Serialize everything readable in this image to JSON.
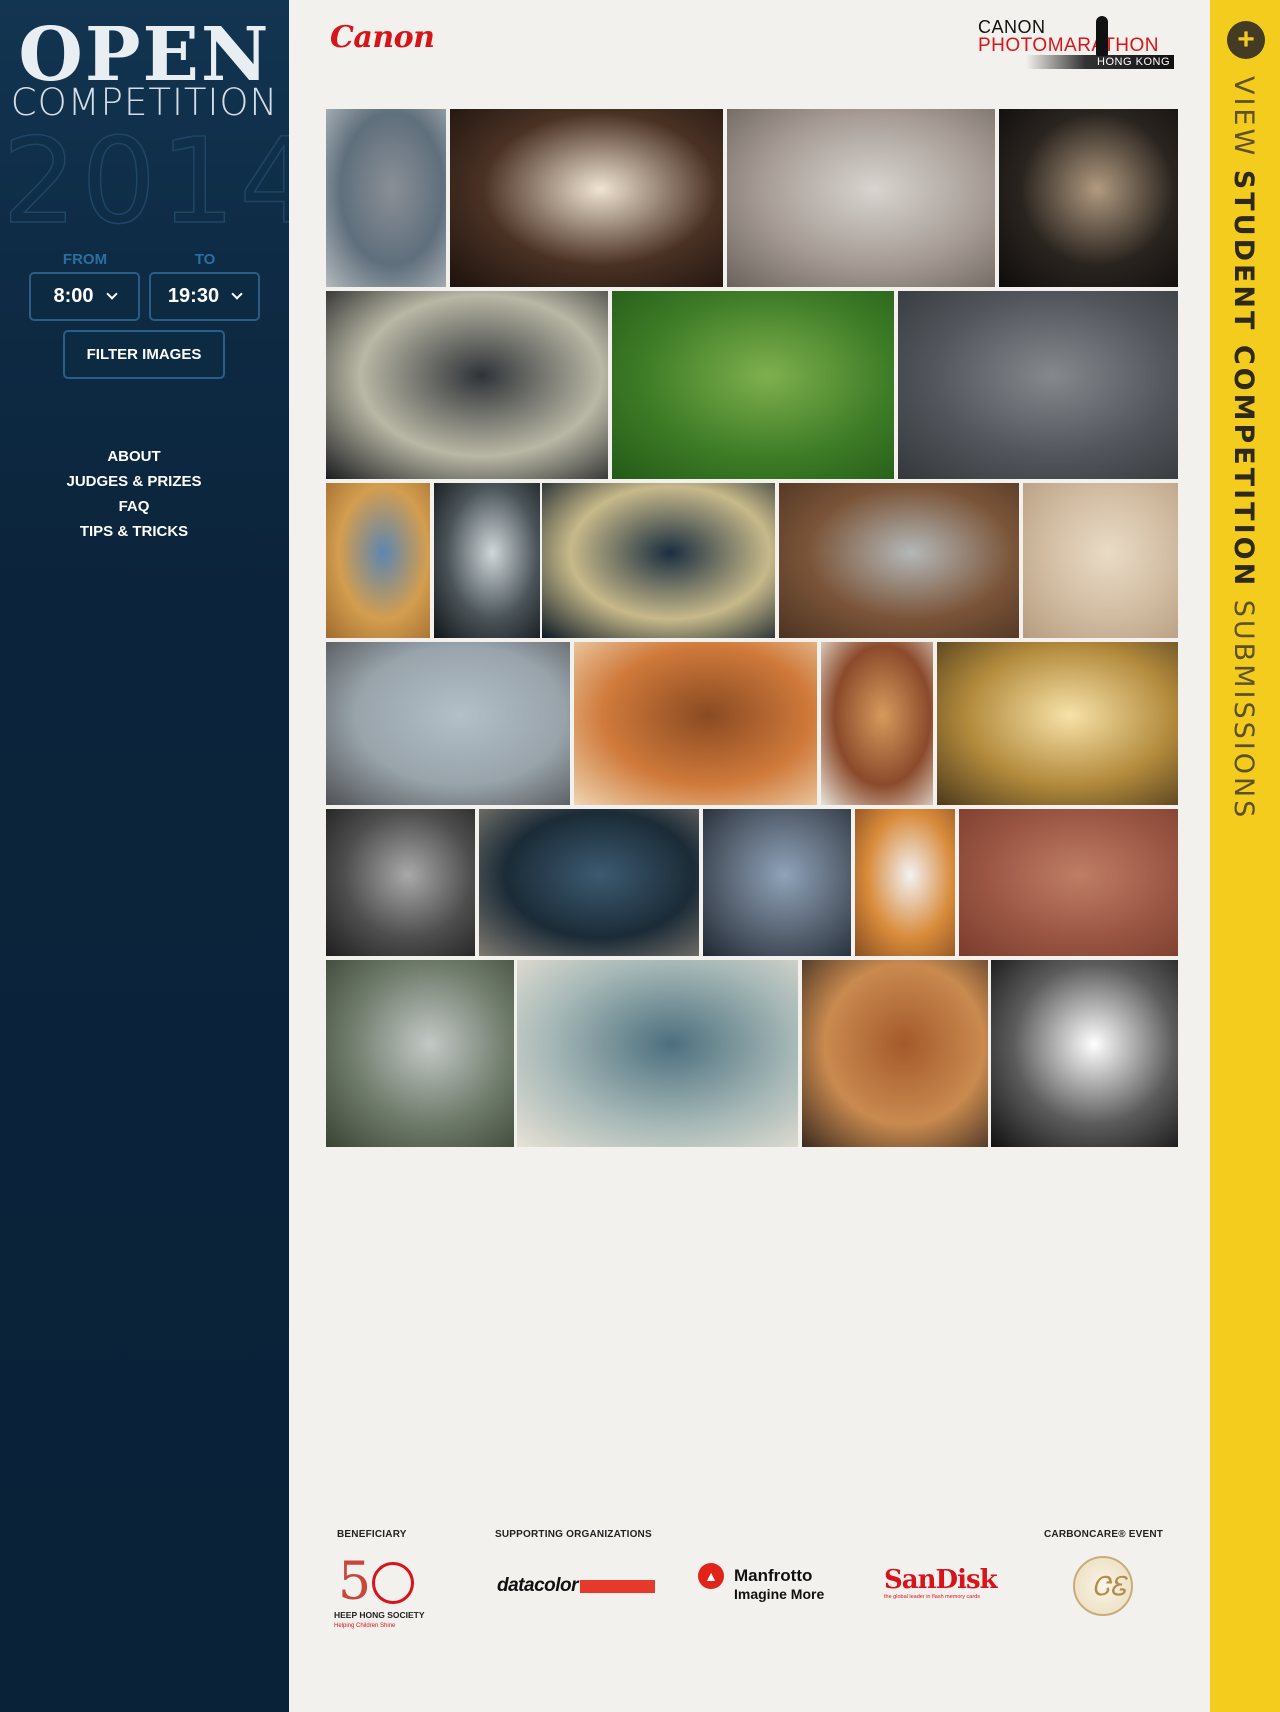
{
  "sidebar": {
    "logo_line1": "OPEN",
    "logo_line2": "COMPETITION",
    "logo_year": "2014",
    "from_label": "FROM",
    "to_label": "TO",
    "from_value": "8:00",
    "to_value": "19:30",
    "filter_label": "FILTER IMAGES",
    "nav": [
      "ABOUT",
      "JUDGES & PRIZES",
      "FAQ",
      "TIPS & TRICKS"
    ]
  },
  "header": {
    "canon_logo": "Canon",
    "photomarathon_line1": "CANON",
    "photomarathon_line2": "PHOTOMARATHON",
    "photomarathon_line3": "HONG KONG"
  },
  "gallery": {
    "photos": [
      {
        "name": "water-droplets-photo",
        "colors": [
          "#8a8f96",
          "#5f6f7c",
          "#b4b9bd"
        ]
      },
      {
        "name": "brown-puppy-photo",
        "colors": [
          "#f0e4d3",
          "#4a3124",
          "#1c120d"
        ]
      },
      {
        "name": "cat-nose-photo",
        "colors": [
          "#d8d4cf",
          "#a59b94",
          "#6b625c"
        ]
      },
      {
        "name": "black-puppy-photo",
        "colors": [
          "#b19a80",
          "#2a241f",
          "#0e0c0b"
        ]
      },
      {
        "name": "tunnel-photo",
        "colors": [
          "#2f3338",
          "#b9b7a5",
          "#1a1c1f"
        ]
      },
      {
        "name": "green-leaf-photo",
        "colors": [
          "#7fb04e",
          "#3f7d27",
          "#235a17"
        ]
      },
      {
        "name": "water-droplets-gray-photo",
        "colors": [
          "#85888d",
          "#52565c",
          "#34373b"
        ]
      },
      {
        "name": "shells-beach-photo",
        "colors": [
          "#5d86b0",
          "#d39e4f",
          "#a16b2f"
        ]
      },
      {
        "name": "forks-photo",
        "colors": [
          "#cfd7da",
          "#4a5358",
          "#111517"
        ]
      },
      {
        "name": "tree-lined-road-photo",
        "colors": [
          "#1b2e40",
          "#c7b98a",
          "#0b1825"
        ]
      },
      {
        "name": "coffee-cup-photo",
        "colors": [
          "#b4b8b8",
          "#7a5438",
          "#4d3322"
        ]
      },
      {
        "name": "footprints-sand-photo",
        "colors": [
          "#eadbc6",
          "#d0bba0",
          "#b69c7f"
        ]
      },
      {
        "name": "foggy-pier-photo",
        "colors": [
          "#b3c0c8",
          "#98a3aa",
          "#4f5155"
        ]
      },
      {
        "name": "red-mug-photo",
        "colors": [
          "#8a4a22",
          "#d07a3b",
          "#efd5b2"
        ]
      },
      {
        "name": "boat-photo",
        "colors": [
          "#d79a5c",
          "#8b4a2b",
          "#e9e4da"
        ]
      },
      {
        "name": "golden-meadow-photo",
        "colors": [
          "#f7e2a8",
          "#b28a3c",
          "#4d3a1c"
        ]
      },
      {
        "name": "grass-bw-photo",
        "colors": [
          "#a9a9a9",
          "#4e4e4e",
          "#1f1f1f"
        ]
      },
      {
        "name": "game-controller-photo",
        "colors": [
          "#3c5a70",
          "#1b2b37",
          "#7f7a70"
        ]
      },
      {
        "name": "phone-photo",
        "colors": [
          "#8fa3b9",
          "#55606f",
          "#1f2833"
        ]
      },
      {
        "name": "laptop-desk-photo",
        "colors": [
          "#f2f2f4",
          "#d88b3a",
          "#8a4e22"
        ]
      },
      {
        "name": "brick-wall-photo",
        "colors": [
          "#c07d65",
          "#9a5643",
          "#7b3c2d"
        ]
      },
      {
        "name": "rainy-window-photo",
        "colors": [
          "#c3c9c6",
          "#6e7a6a",
          "#3a4434"
        ]
      },
      {
        "name": "clouds-photo",
        "colors": [
          "#4c6f7e",
          "#a5b7b6",
          "#e8e2d6"
        ]
      },
      {
        "name": "cafe-table-photo",
        "colors": [
          "#a55a2b",
          "#c98a4f",
          "#3b2a20"
        ]
      },
      {
        "name": "feet-silhouette-photo",
        "colors": [
          "#ffffff",
          "#5c5c5c",
          "#111111"
        ]
      }
    ]
  },
  "footer": {
    "beneficiary_label": "BENEFICIARY",
    "supporting_label": "SUPPORTING ORGANIZATIONS",
    "carboncare_label": "CARBONCARE® EVENT",
    "heep_50": "5",
    "heep_name": "HEEP HONG SOCIETY",
    "heep_sub": "Helping Children Shine",
    "datacolor": "datacolor",
    "manfrotto_name": "Manfrotto",
    "manfrotto_tag": "Imagine More",
    "sandisk": "SanDisk",
    "sandisk_tag": "the global leader in flash memory cards"
  },
  "rail": {
    "plus": "+",
    "text_view": "VIEW ",
    "text_bold": "STUDENT COMPETITION",
    "text_end": " SUBMISSIONS"
  },
  "colors": {
    "sidebar_bg": "#0b243b",
    "rail_bg": "#f3cc1d",
    "canon_red": "#d7141a",
    "page_bg": "#f3f1ed"
  }
}
